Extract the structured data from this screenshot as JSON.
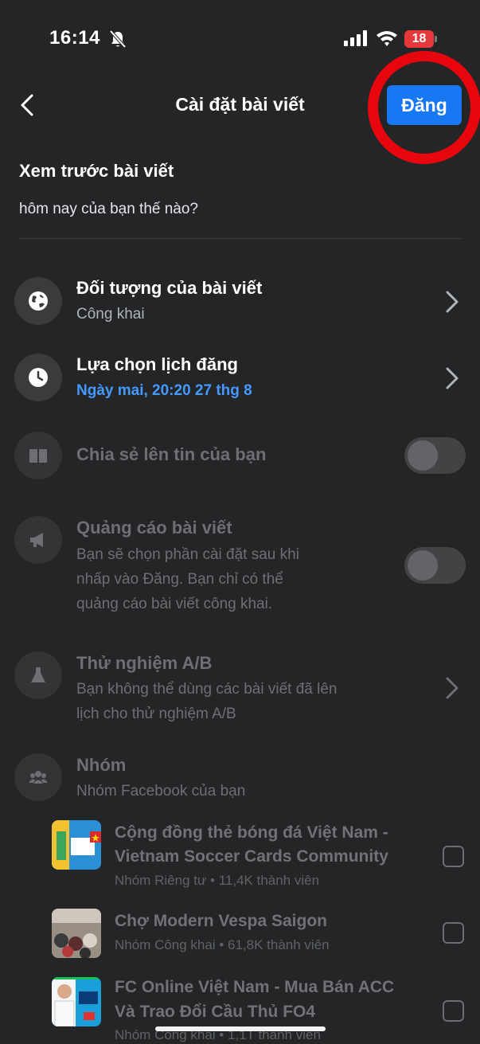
{
  "status": {
    "time": "16:14",
    "battery": "18"
  },
  "nav": {
    "title": "Cài đặt bài viết",
    "post_label": "Đăng"
  },
  "preview": {
    "title": "Xem trước bài viết",
    "text": "hôm nay của bạn thế nào?"
  },
  "settings": {
    "audience": {
      "title": "Đối tượng của bài viết",
      "value": "Công khai"
    },
    "schedule": {
      "title": "Lựa chọn lịch đăng",
      "value": "Ngày mai, 20:20 27 thg 8"
    },
    "story": {
      "title": "Chia sẻ lên tin của bạn",
      "toggle_on": false
    },
    "boost": {
      "title": "Quảng cáo bài viết",
      "line1": "Bạn sẽ chọn phần cài đặt sau khi",
      "line2": "nhấp vào Đăng. Bạn chỉ có thể",
      "line3": "quảng cáo bài viết công khai.",
      "toggle_on": false
    },
    "ab_test": {
      "title": "Thử nghiệm A/B",
      "line1": "Bạn không thể dùng các bài viết đã lên",
      "line2": "lịch cho thử nghiệm A/B"
    },
    "groups": {
      "title": "Nhóm",
      "subtitle": "Nhóm Facebook của bạn"
    }
  },
  "groups": [
    {
      "name_line1": "Cộng đồng thẻ bóng đá Việt Nam -",
      "name_line2": "Vietnam Soccer Cards Community",
      "meta": "Nhóm Riêng tư • 11,4K thành viên",
      "checked": false
    },
    {
      "name_line1": "Chợ Modern Vespa Saigon",
      "meta": "Nhóm Công khai • 61,8K thành viên",
      "checked": false
    },
    {
      "name_line1": "FC Online Việt Nam - Mua Bán ACC",
      "name_line2": "Và Trao Đổi Cầu Thủ FO4",
      "meta": "Nhóm Công khai • 1,1T thành viên",
      "checked": false
    }
  ],
  "colors": {
    "background": "#242526",
    "accent": "#1877f2",
    "link_blue": "#4599ff",
    "highlight_ring": "#e8060e"
  }
}
